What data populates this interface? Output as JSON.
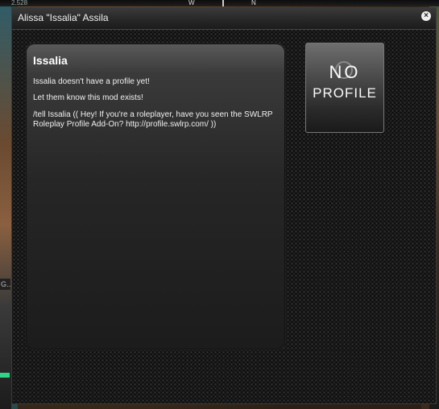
{
  "hud": {
    "top_small": "2.528",
    "compass_w": "W",
    "compass_n": "N",
    "left_tag": "G..."
  },
  "window": {
    "title": "Alissa \"Issalia\" Assila",
    "close_glyph": "×"
  },
  "profile": {
    "name": "Issalia",
    "line1": "Issalia doesn't have a profile yet!",
    "line2": "Let them know this mod exists!",
    "line3": "/tell Issalia (( Hey! If you're a roleplayer, have you seen the SWLRP Roleplay Profile Add-On? http://profile.swlrp.com/ ))"
  },
  "no_profile_image": {
    "word1": "NO",
    "word2": "PROFILE"
  },
  "colors": {
    "accent_green": "#2fd38a",
    "text": "#f0f0f0"
  }
}
